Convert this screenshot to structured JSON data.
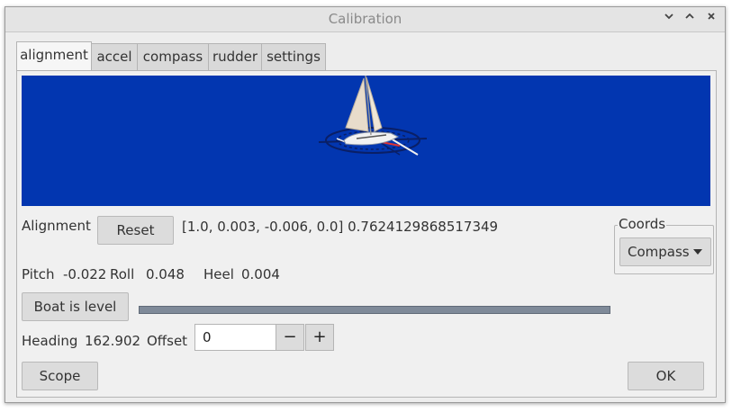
{
  "window": {
    "title": "Calibration",
    "controls": {
      "minimize": "⌄",
      "maximize": "⌃",
      "close": "✕"
    }
  },
  "tabs": [
    {
      "label": "alignment",
      "active": true
    },
    {
      "label": "accel",
      "active": false
    },
    {
      "label": "compass",
      "active": false
    },
    {
      "label": "rudder",
      "active": false
    },
    {
      "label": "settings",
      "active": false
    }
  ],
  "alignment": {
    "label": "Alignment",
    "reset_button": "Reset",
    "value": "[1.0, 0.003, -0.006, 0.0] 0.7624129868517349"
  },
  "coords": {
    "title": "Coords",
    "selected": "Compass",
    "dropdown_icon": "caret-down-icon"
  },
  "attitude": {
    "pitch_label": "Pitch",
    "pitch_value": "-0.022",
    "roll_label": "Roll",
    "roll_value": "0.048",
    "heel_label": "Heel",
    "heel_value": "0.004"
  },
  "level": {
    "button": "Boat is level"
  },
  "heading": {
    "label": "Heading",
    "value": "162.902",
    "offset_label": "Offset",
    "offset_value": "0",
    "decrement": "−",
    "increment": "+"
  },
  "footer": {
    "scope_button": "Scope",
    "ok_button": "OK"
  },
  "colors": {
    "preview_background": "#0236b0",
    "sail": "#e8dccb",
    "progress_bar": "#7f8a99"
  }
}
